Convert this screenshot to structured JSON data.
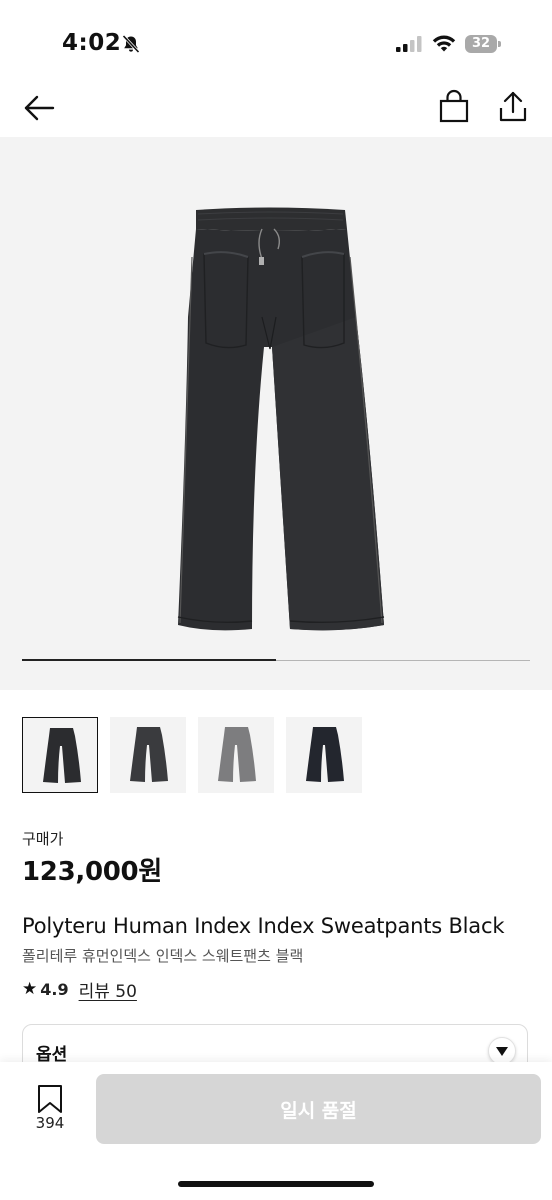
{
  "status_bar": {
    "time": "4:02",
    "battery": "32"
  },
  "nav": {
    "back_icon": "arrow-left-icon",
    "bag_icon": "shopping-bag-icon",
    "share_icon": "share-icon"
  },
  "gallery": {
    "image": "black-wide-leg-sweatpants",
    "progress": 0.5,
    "thumbnails": [
      {
        "image": "black-sweatpants-front",
        "selected": true
      },
      {
        "image": "charcoal-sweatpants",
        "selected": false
      },
      {
        "image": "grey-sweatpants",
        "selected": false
      },
      {
        "image": "navy-sweatpants",
        "selected": false
      }
    ]
  },
  "product": {
    "price_label": "구매가",
    "price": "123,000원",
    "title": "Polyteru Human Index Index Sweatpants Black",
    "subtitle": "폴리테루 휴먼인덱스 인덱스 스웨트팬츠 블랙",
    "rating_star": "★",
    "rating": "4.9",
    "review_link": "리뷰 50"
  },
  "options": {
    "label": "옵션"
  },
  "bottom_bar": {
    "bookmark_count": "394",
    "soldout_label": "일시 품절"
  },
  "colors": {
    "accent": "#111111",
    "disabled_button": "#d6d6d6",
    "image_background": "#f3f3f3"
  }
}
